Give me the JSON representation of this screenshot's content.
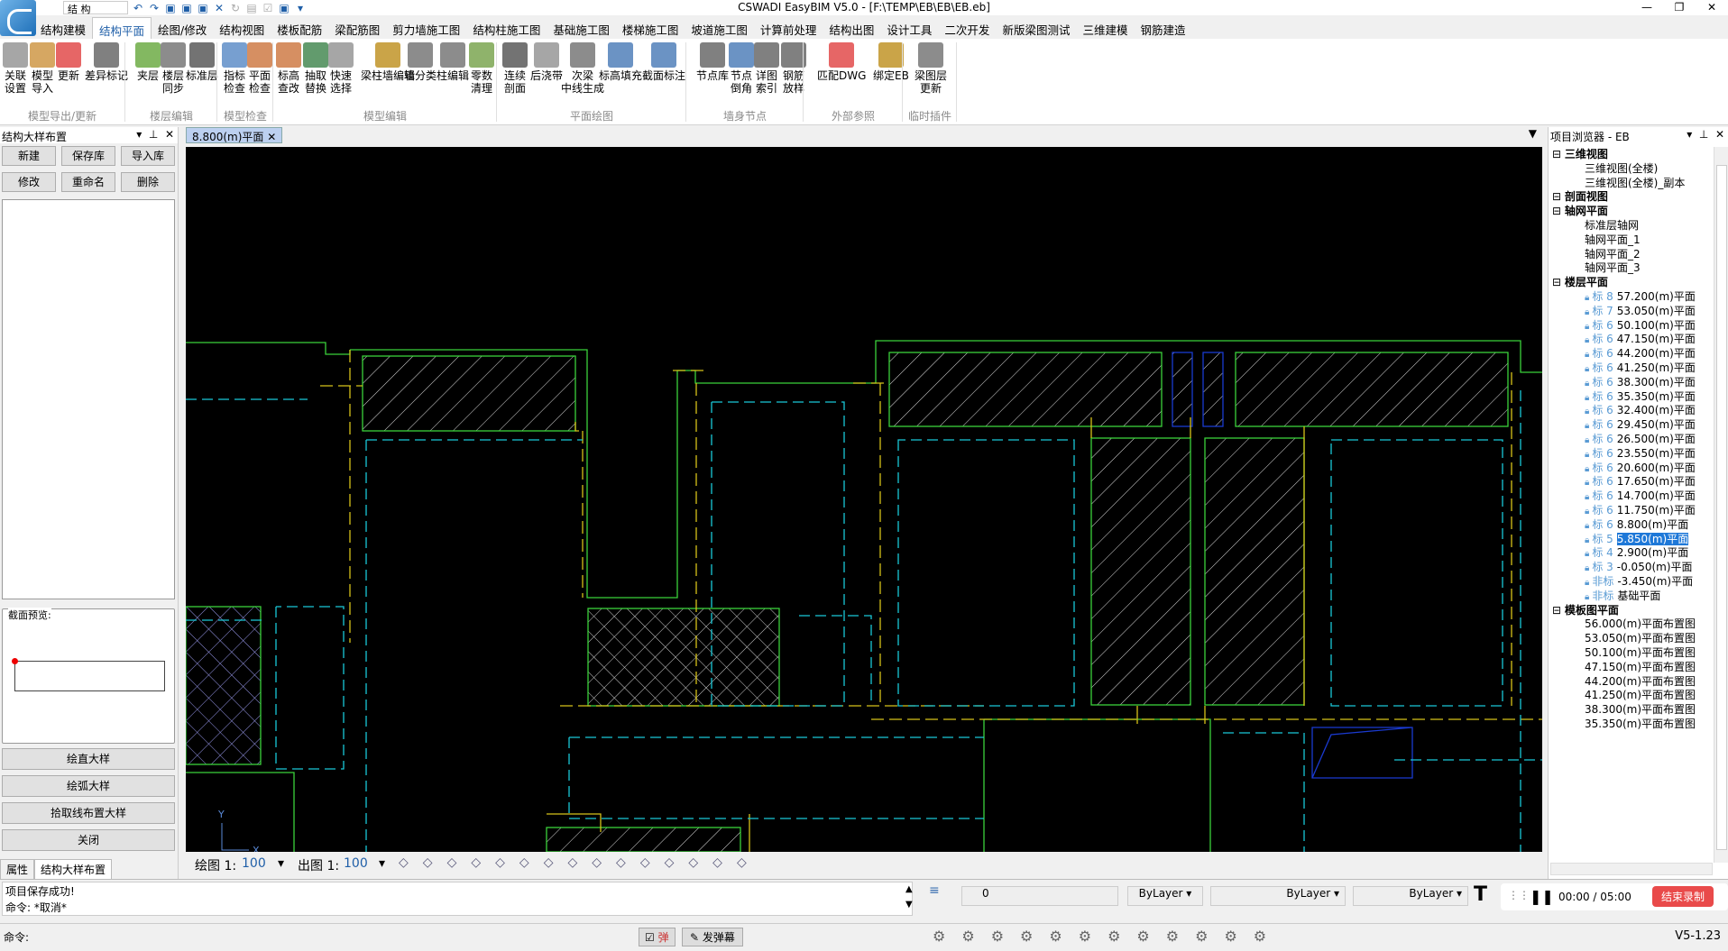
{
  "app": {
    "title": "CSWADI EasyBIM V5.0 - [F:\\TEMP\\EB\\EB\\EB.eb]",
    "workspace": "结 构",
    "window_min": "—",
    "window_max": "❐",
    "window_close": "✕"
  },
  "menu": [
    "结构建模",
    "结构平面",
    "绘图/修改",
    "结构视图",
    "楼板配筋",
    "梁配筋图",
    "剪力墙施工图",
    "结构柱施工图",
    "基础施工图",
    "楼梯施工图",
    "坡道施工图",
    "计算前处理",
    "结构出图",
    "设计工具",
    "二次开发",
    "新版梁图测试",
    "三维建模",
    "钢筋建造"
  ],
  "ribbon": {
    "buttons": [
      {
        "label": "关联\n设置",
        "color": "#888"
      },
      {
        "label": "模型\n导入",
        "color": "#c88a2e"
      },
      {
        "label": "更新",
        "color": "#d33"
      },
      {
        "label": "差异标记",
        "color": "#555"
      },
      {
        "label": "夹层",
        "color": "#5aa02c"
      },
      {
        "label": "楼层\n同步",
        "color": "#666"
      },
      {
        "label": "标准层",
        "color": "#444"
      },
      {
        "label": "指标\n检查",
        "color": "#4a7fc0"
      },
      {
        "label": "平面\n检查",
        "color": "#c86a2e"
      },
      {
        "label": "标高\n查改",
        "color": "#c86a2e"
      },
      {
        "label": "抽取\n替换",
        "color": "#2e7a3c"
      },
      {
        "label": "快速\n选择",
        "color": "#888"
      },
      {
        "label": "梁柱墙编辑",
        "color": "#b8860b"
      },
      {
        "label": "墙分类",
        "color": "#666"
      },
      {
        "label": "柱编辑",
        "color": "#666"
      },
      {
        "label": "零数\n清理",
        "color": "#6a9a3a"
      },
      {
        "label": "连续\n剖面",
        "color": "#444"
      },
      {
        "label": "后浇带",
        "color": "#888"
      },
      {
        "label": "次梁\n中线生成",
        "color": "#666"
      },
      {
        "label": "标高填充",
        "color": "#3a6fb0"
      },
      {
        "label": "截面标注",
        "color": "#3a6fb0"
      },
      {
        "label": "节点库",
        "color": "#555"
      },
      {
        "label": "节点\n倒角",
        "color": "#3a6fb0"
      },
      {
        "label": "详图\n索引",
        "color": "#555"
      },
      {
        "label": "钢筋\n放样",
        "color": "#555"
      },
      {
        "label": "匹配DWG",
        "color": "#d33"
      },
      {
        "label": "绑定EB",
        "color": "#b8860b"
      },
      {
        "label": "梁图层\n更新",
        "color": "#666"
      }
    ],
    "groups": [
      "模型导出/更新",
      "楼层编辑",
      "模型检查",
      "模型编辑",
      "平面绘图",
      "墙身节点",
      "外部参照",
      "临时插件"
    ]
  },
  "left_panel": {
    "title": "结构大样布置",
    "buttons": [
      "新建",
      "保存库",
      "导入库",
      "修改",
      "重命名",
      "删除"
    ],
    "preview_label": "截面预览:",
    "actions": [
      "绘直大样",
      "绘弧大样",
      "拾取线布置大样",
      "关闭"
    ],
    "tabs": [
      "属性",
      "结构大样布置"
    ]
  },
  "canvas": {
    "tab": "8.800(m)平面",
    "scale_draw_label": "绘图 1:",
    "scale_draw": "100",
    "scale_out_label": "出图 1:",
    "scale_out": "100"
  },
  "browser": {
    "title": "项目浏览器 - EB",
    "nodes": [
      {
        "t": "三维视图",
        "lvl": 0,
        "bold": true
      },
      {
        "t": "三维视图(全楼)",
        "lvl": 1
      },
      {
        "t": "三维视图(全楼)_副本",
        "lvl": 1
      },
      {
        "t": "剖面视图",
        "lvl": 0,
        "bold": true
      },
      {
        "t": "轴网平面",
        "lvl": 0,
        "bold": true
      },
      {
        "t": "标准层轴网",
        "lvl": 1
      },
      {
        "t": "轴网平面_1",
        "lvl": 1
      },
      {
        "t": "轴网平面_2",
        "lvl": 1
      },
      {
        "t": "轴网平面_3",
        "lvl": 1
      },
      {
        "t": "楼层平面",
        "lvl": 0,
        "bold": true
      },
      {
        "t": "57.200(m)平面",
        "tag": "标 8",
        "lvl": 1
      },
      {
        "t": "53.050(m)平面",
        "tag": "标 7",
        "lvl": 1
      },
      {
        "t": "50.100(m)平面",
        "tag": "标 6",
        "lvl": 1
      },
      {
        "t": "47.150(m)平面",
        "tag": "标 6",
        "lvl": 1
      },
      {
        "t": "44.200(m)平面",
        "tag": "标 6",
        "lvl": 1
      },
      {
        "t": "41.250(m)平面",
        "tag": "标 6",
        "lvl": 1
      },
      {
        "t": "38.300(m)平面",
        "tag": "标 6",
        "lvl": 1
      },
      {
        "t": "35.350(m)平面",
        "tag": "标 6",
        "lvl": 1
      },
      {
        "t": "32.400(m)平面",
        "tag": "标 6",
        "lvl": 1
      },
      {
        "t": "29.450(m)平面",
        "tag": "标 6",
        "lvl": 1
      },
      {
        "t": "26.500(m)平面",
        "tag": "标 6",
        "lvl": 1
      },
      {
        "t": "23.550(m)平面",
        "tag": "标 6",
        "lvl": 1
      },
      {
        "t": "20.600(m)平面",
        "tag": "标 6",
        "lvl": 1
      },
      {
        "t": "17.650(m)平面",
        "tag": "标 6",
        "lvl": 1
      },
      {
        "t": "14.700(m)平面",
        "tag": "标 6",
        "lvl": 1
      },
      {
        "t": "11.750(m)平面",
        "tag": "标 6",
        "lvl": 1
      },
      {
        "t": "8.800(m)平面",
        "tag": "标 6",
        "lvl": 1
      },
      {
        "t": "5.850(m)平面",
        "tag": "标 5",
        "lvl": 1,
        "sel": true
      },
      {
        "t": "2.900(m)平面",
        "tag": "标 4",
        "lvl": 1
      },
      {
        "t": "-0.050(m)平面",
        "tag": "标 3",
        "lvl": 1
      },
      {
        "t": "-3.450(m)平面",
        "tag": "非标",
        "lvl": 1
      },
      {
        "t": "基础平面",
        "tag": "非标",
        "lvl": 1
      },
      {
        "t": "模板图平面",
        "lvl": 0,
        "bold": true
      },
      {
        "t": "56.000(m)平面布置图",
        "lvl": 1
      },
      {
        "t": "53.050(m)平面布置图",
        "lvl": 1
      },
      {
        "t": "50.100(m)平面布置图",
        "lvl": 1
      },
      {
        "t": "47.150(m)平面布置图",
        "lvl": 1
      },
      {
        "t": "44.200(m)平面布置图",
        "lvl": 1
      },
      {
        "t": "41.250(m)平面布置图",
        "lvl": 1
      },
      {
        "t": "38.300(m)平面布置图",
        "lvl": 1
      },
      {
        "t": "35.350(m)平面布置图",
        "lvl": 1
      }
    ]
  },
  "command": {
    "line1": "项目保存成功!",
    "line2": "命令: *取消*",
    "prompt": "命令:",
    "layer": "0",
    "bylayer1": "ByLayer",
    "bylayer2": "ByLayer",
    "bylayer3": "ByLayer",
    "popup": "弹",
    "danmu": "发弹幕",
    "timer": "00:00 / 05:00",
    "end_rec": "结束录制",
    "version": "V5-1.23"
  }
}
